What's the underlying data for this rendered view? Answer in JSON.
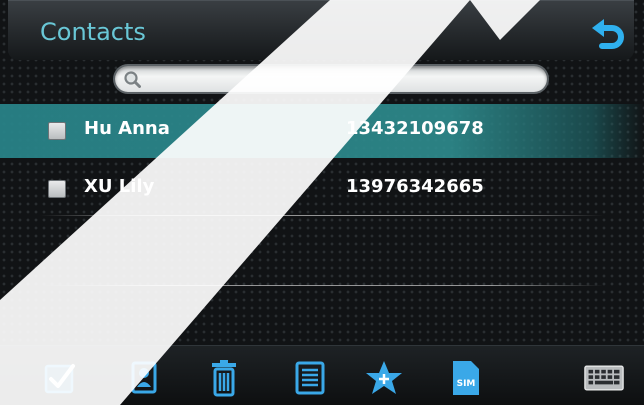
{
  "header": {
    "title": "Contacts"
  },
  "search": {
    "value": "",
    "placeholder": ""
  },
  "contacts": [
    {
      "name": "Hu Anna",
      "phone": "13432109678",
      "selected": true
    },
    {
      "name": "XU Lily",
      "phone": "13976342665",
      "selected": false
    }
  ],
  "toolbar": {
    "items": [
      {
        "icon": "checkbox-icon"
      },
      {
        "icon": "contact-card-icon"
      },
      {
        "icon": "trash-icon"
      },
      {
        "icon": "list-icon"
      },
      {
        "icon": "star-add-icon"
      },
      {
        "icon": "sim-card-icon",
        "label": "SIM"
      },
      {
        "icon": "keyboard-icon"
      }
    ]
  },
  "colors": {
    "accent": "#69c7d6",
    "selected_row": "#2e8c8e",
    "icon_blue": "#3aa8e8"
  }
}
